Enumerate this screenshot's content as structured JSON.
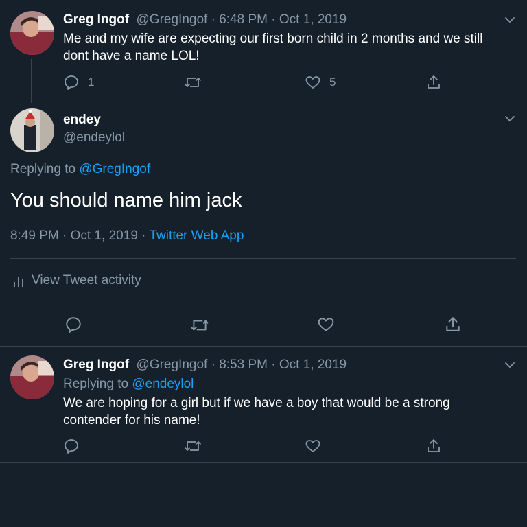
{
  "tweet1": {
    "name": "Greg Ingof",
    "handle": "@GregIngof",
    "sep1": " · ",
    "time": "6:48 PM",
    "sep2": " · ",
    "date": "Oct 1, 2019",
    "text_line1": "Me and my wife are expecting our first born child in 2 months and we still",
    "text_line2": "dont have a name LOL!",
    "reply_count": "1",
    "like_count": "5"
  },
  "main_tweet": {
    "name": "endey",
    "handle": "@endeylol",
    "replying_prefix": "Replying to ",
    "replying_to": "@GregIngof",
    "text": "You should name him jack",
    "time": "8:49 PM",
    "sep1": " · ",
    "date": "Oct 1, 2019",
    "sep2": " · ",
    "source": "Twitter Web App",
    "activity_label": "View Tweet activity"
  },
  "tweet3": {
    "name": "Greg Ingof",
    "handle": "@GregIngof",
    "sep1": " · ",
    "time": "8:53 PM",
    "sep2": " · ",
    "date": "Oct 1, 2019",
    "replying_prefix": "Replying to ",
    "replying_to": "@endeylol",
    "text_line1": "We are hoping for a girl but if we have a boy that would be a strong",
    "text_line2": "contender for his name!"
  },
  "colors": {
    "background": "#15202b",
    "muted": "#8899a6",
    "link": "#1da1f2",
    "divider": "#38444d"
  }
}
